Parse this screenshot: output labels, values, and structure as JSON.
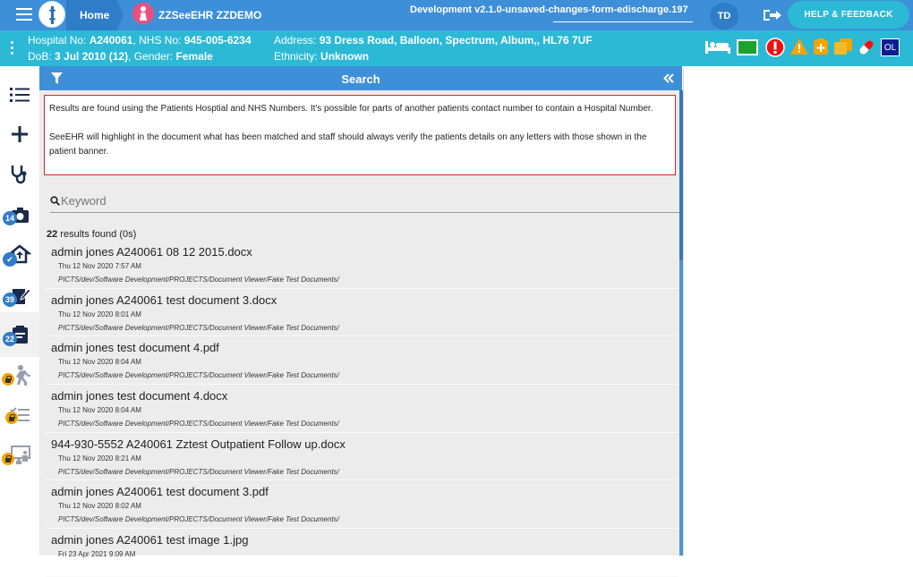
{
  "topbar": {
    "home_label": "Home",
    "patient_name": "ZZSeeEHR ZZDEMO",
    "environment": "Development v2.1.0-unsaved-changes-form-edischarge.197",
    "user_initials": "TD",
    "help_label": "HELP & FEEDBACK"
  },
  "banner": {
    "hospital_no_label": "Hospital No:",
    "hospital_no": "A240061",
    "nhs_no_label": "NHS No:",
    "nhs_no": "945-005-6234",
    "dob_label": "DoB:",
    "dob": "3 Jul 2010 (12)",
    "gender_label": "Gender:",
    "gender": "Female",
    "address_label": "Address:",
    "address": "93 Dress Road, Balloon, Spectrum, Album,, HL76 7UF",
    "ethnicity_label": "Ethnicity:",
    "ethnicity": "Unknown",
    "ol_badge": "OL"
  },
  "sidebar": {
    "badges": [
      "14",
      "39",
      "22"
    ]
  },
  "search": {
    "title": "Search",
    "info_line1": "Results are found using the Patients Hosptial and NHS Numbers. It's possible for parts of another patients contact number to contain a Hospital Number.",
    "info_line2": "SeeEHR will highlight in the document what has been matched and staff should always verify the patients details on any letters with those shown in the patient banner.",
    "keyword_placeholder": "Keyword",
    "results_count": "22",
    "results_suffix": " results found (0s)",
    "results": [
      {
        "title": "admin jones A240061 08 12 2015.docx",
        "date": "Thu 12 Nov 2020 7:57 AM",
        "path": "PICTS/dev/Software Development/PROJECTS/Document Viewer/Fake Test Documents/"
      },
      {
        "title": "admin jones A240061 test document 3.docx",
        "date": "Thu 12 Nov 2020 8:01 AM",
        "path": "PICTS/dev/Software Development/PROJECTS/Document Viewer/Fake Test Documents/"
      },
      {
        "title": "admin jones test document 4.pdf",
        "date": "Thu 12 Nov 2020 8:04 AM",
        "path": "PICTS/dev/Software Development/PROJECTS/Document Viewer/Fake Test Documents/"
      },
      {
        "title": "admin jones test document 4.docx",
        "date": "Thu 12 Nov 2020 8:04 AM",
        "path": "PICTS/dev/Software Development/PROJECTS/Document Viewer/Fake Test Documents/"
      },
      {
        "title": "944-930-5552 A240061 Zztest Outpatient Follow up.docx",
        "date": "Thu 12 Nov 2020 8:21 AM",
        "path": "PICTS/dev/Software Development/PROJECTS/Document Viewer/Fake Test Documents/"
      },
      {
        "title": "admin jones A240061 test document 3.pdf",
        "date": "Thu 12 Nov 2020 8:02 AM",
        "path": "PICTS/dev/Software Development/PROJECTS/Document Viewer/Fake Test Documents/"
      },
      {
        "title": "admin jones A240061 test image 1.jpg",
        "date": "Fri 23 Apr 2021 9:09 AM",
        "path": ""
      }
    ]
  },
  "colors": {
    "topbar": "#3d8fd8",
    "banner": "#2cb9d6",
    "alert_red": "#e11",
    "warning": "#f2a400"
  }
}
